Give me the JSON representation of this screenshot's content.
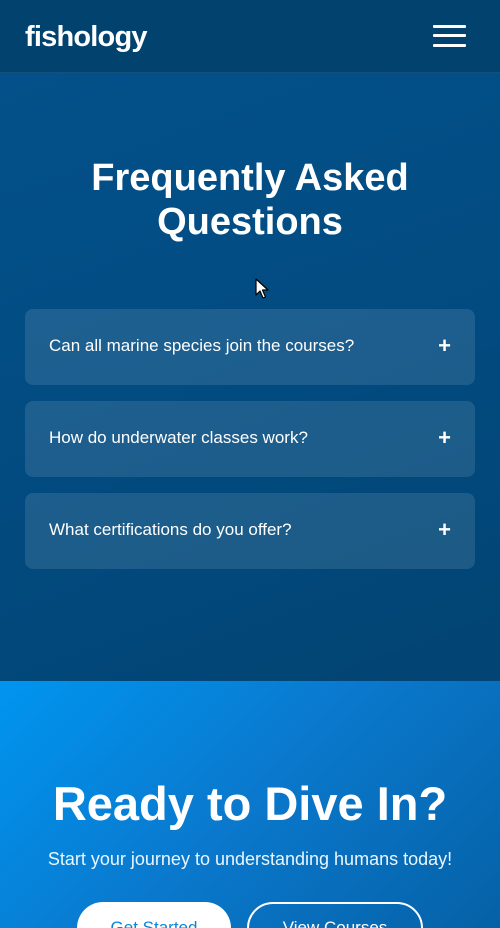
{
  "header": {
    "logo": "fishology",
    "menu_icon": "hamburger-menu-icon"
  },
  "faq": {
    "title": "Frequently Asked Questions",
    "toggle_symbol": "+",
    "items": [
      {
        "question": "Can all marine species join the courses?"
      },
      {
        "question": "How do underwater classes work?"
      },
      {
        "question": "What certifications do you offer?"
      }
    ]
  },
  "cta": {
    "title": "Ready to Dive In?",
    "subtitle": "Start your journey to understanding humans today!",
    "primary_button": "Get Started",
    "secondary_button": "View Courses"
  },
  "colors": {
    "header_bg": "#02426f",
    "faq_bg": "#03508a",
    "cta_bg": "#0095f0",
    "primary_button_text": "#0a86d8"
  }
}
